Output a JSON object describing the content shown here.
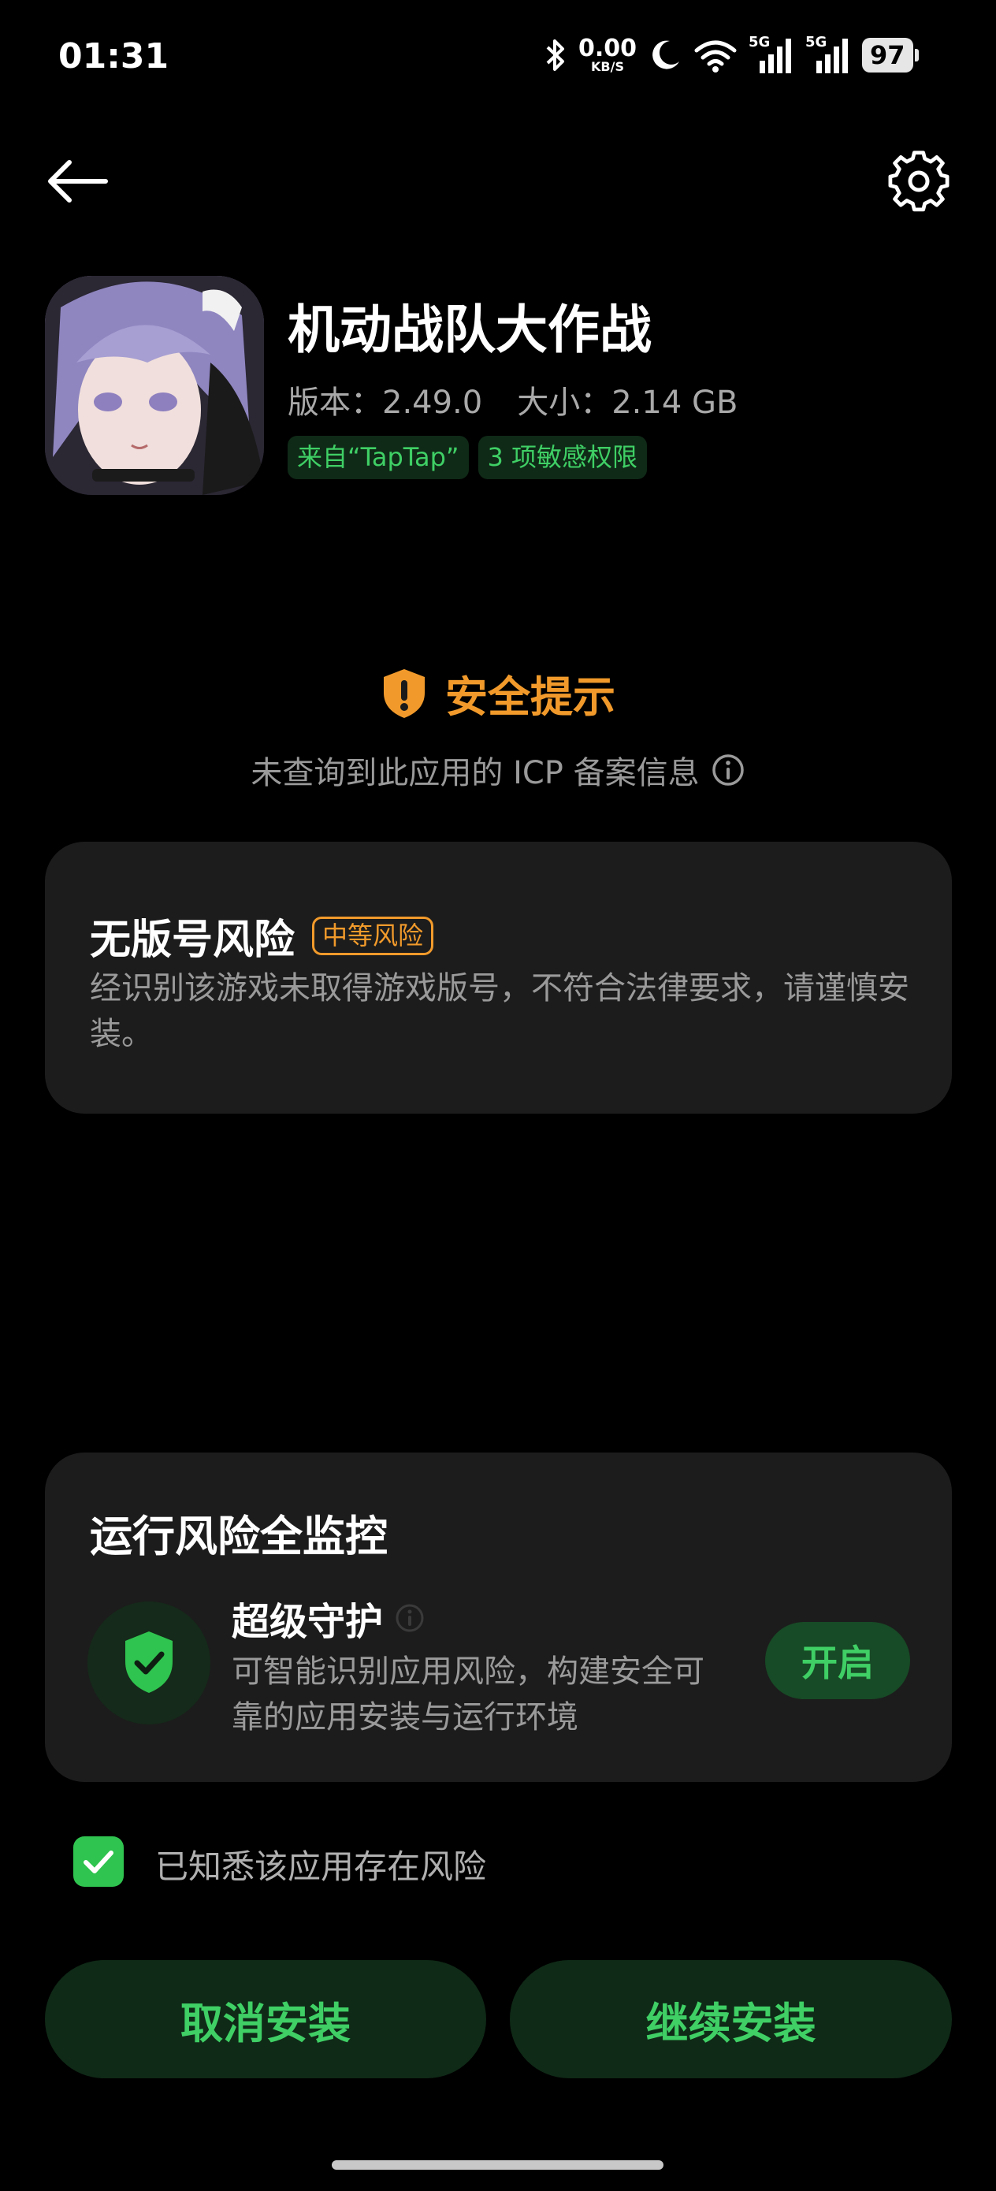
{
  "status_bar": {
    "time": "01:31",
    "net_speed_value": "0.00",
    "net_speed_unit": "KB/S",
    "signal1_label": "5G",
    "signal2_label": "5G",
    "battery": "97"
  },
  "app": {
    "name": "机动战队大作战",
    "version": "版本：2.49.0",
    "size": "大小：2.14 GB",
    "tags": [
      "来自“TapTap”",
      "3 项敏感权限"
    ]
  },
  "notice": {
    "title": "安全提示",
    "subtitle": "未查询到此应用的 ICP 备案信息"
  },
  "risk_card": {
    "title": "无版号风险",
    "badge": "中等风险",
    "description": "经识别该游戏未取得游戏版号，不符合法律要求，请谨慎安装。"
  },
  "monitor_card": {
    "title": "运行风险全监控",
    "guard_title": "超级守护",
    "guard_description": "可智能识别应用风险，构建安全可靠的应用安装与运行环境",
    "enable_label": "开启"
  },
  "acknowledge": {
    "label": "已知悉该应用存在风险",
    "checked": true
  },
  "actions": {
    "cancel_label": "取消安装",
    "continue_label": "继续安装"
  },
  "colors": {
    "accent_green": "#3fcf65",
    "warning_orange": "#f19a2b",
    "card_bg": "#1c1c1c",
    "button_bg": "#0f2a17"
  },
  "icons": {
    "back": "arrow-left-icon",
    "settings": "gear-icon",
    "notice": "shield-exclamation-icon",
    "info": "info-circle-icon",
    "guard": "shield-check-icon",
    "checkbox": "checkmark-icon"
  }
}
